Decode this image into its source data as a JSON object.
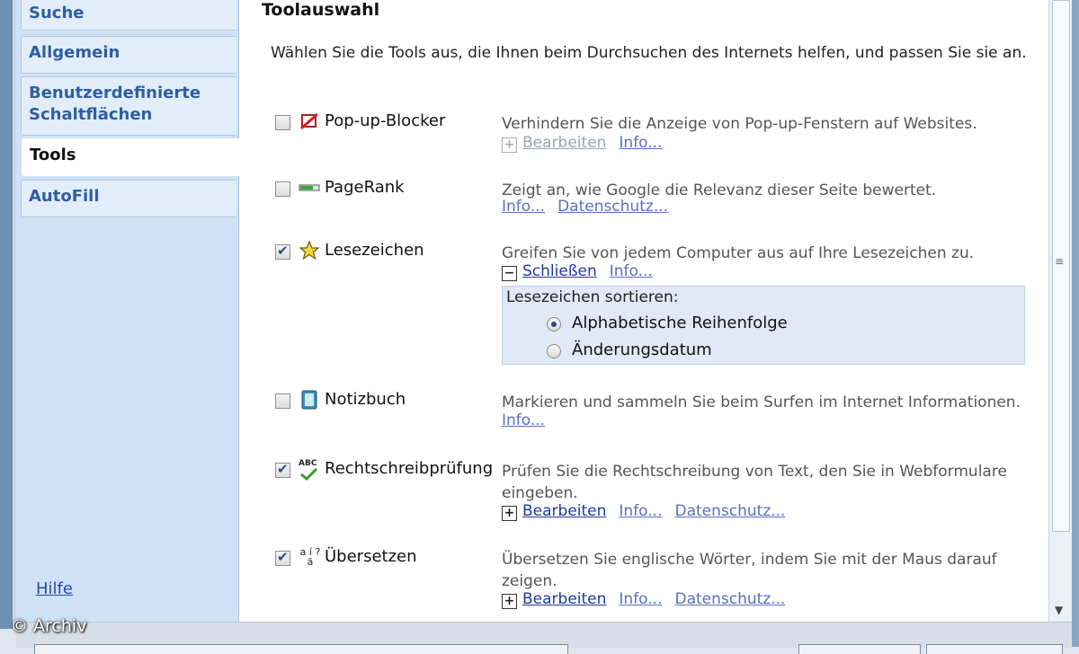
{
  "sidebar": {
    "items": [
      {
        "label": "Suche",
        "active": false
      },
      {
        "label": "Allgemein",
        "active": false
      },
      {
        "label": "Benutzerdefinierte Schaltflächen",
        "active": false
      },
      {
        "label": "Tools",
        "active": true
      },
      {
        "label": "AutoFill",
        "active": false
      }
    ],
    "help_label": "Hilfe"
  },
  "watermark": "© Archiv",
  "main": {
    "title": "Toolauswahl",
    "intro": "Wählen Sie die Tools aus, die Ihnen beim Durchsuchen des Internets helfen, und passen Sie sie an.",
    "tools": [
      {
        "name": "Pop-up-Blocker",
        "checked": false,
        "icon": "popup-blocker-icon",
        "description": "Verhindern Sie die Anzeige von Pop-up-Fenstern auf Websites.",
        "links": {
          "edit": "Bearbeiten",
          "info": "Info..."
        }
      },
      {
        "name": "PageRank",
        "checked": false,
        "icon": "pagerank-bar-icon",
        "description": "Zeigt an, wie Google die Relevanz dieser Seite bewertet.",
        "links": {
          "info": "Info...",
          "privacy": "Datenschutz..."
        }
      },
      {
        "name": "Lesezeichen",
        "checked": true,
        "icon": "star-icon",
        "description": "Greifen Sie von jedem Computer aus auf Ihre Lesezeichen zu.",
        "links": {
          "close": "Schließen",
          "info": "Info..."
        },
        "sort": {
          "label": "Lesezeichen sortieren:",
          "options": [
            "Alphabetische Reihenfolge",
            "Änderungsdatum"
          ],
          "selected": 0
        }
      },
      {
        "name": "Notizbuch",
        "checked": false,
        "icon": "notebook-icon",
        "description": "Markieren und sammeln Sie beim Surfen im Internet Informationen.",
        "links": {
          "info": "Info..."
        }
      },
      {
        "name": "Rechtschreibprüfung",
        "checked": true,
        "icon": "spellcheck-icon",
        "icon_text": "ABC",
        "description": "Prüfen Sie die Rechtschreibung von Text, den Sie in Webformulare eingeben.",
        "links": {
          "edit": "Bearbeiten",
          "info": "Info...",
          "privacy": "Datenschutz..."
        }
      },
      {
        "name": "Übersetzen",
        "checked": true,
        "icon": "translate-icon",
        "icon_text": "a í ?ä",
        "description": "Übersetzen Sie englische Wörter, indem Sie mit der Maus darauf zeigen.",
        "links": {
          "edit": "Bearbeiten",
          "info": "Info...",
          "privacy": "Datenschutz..."
        }
      }
    ]
  },
  "colors": {
    "sidebar_bg": "#cfe1f7",
    "nav_text": "#2d5fa3",
    "link": "#5a6fc0",
    "sort_box_bg": "#e1e9f6"
  }
}
